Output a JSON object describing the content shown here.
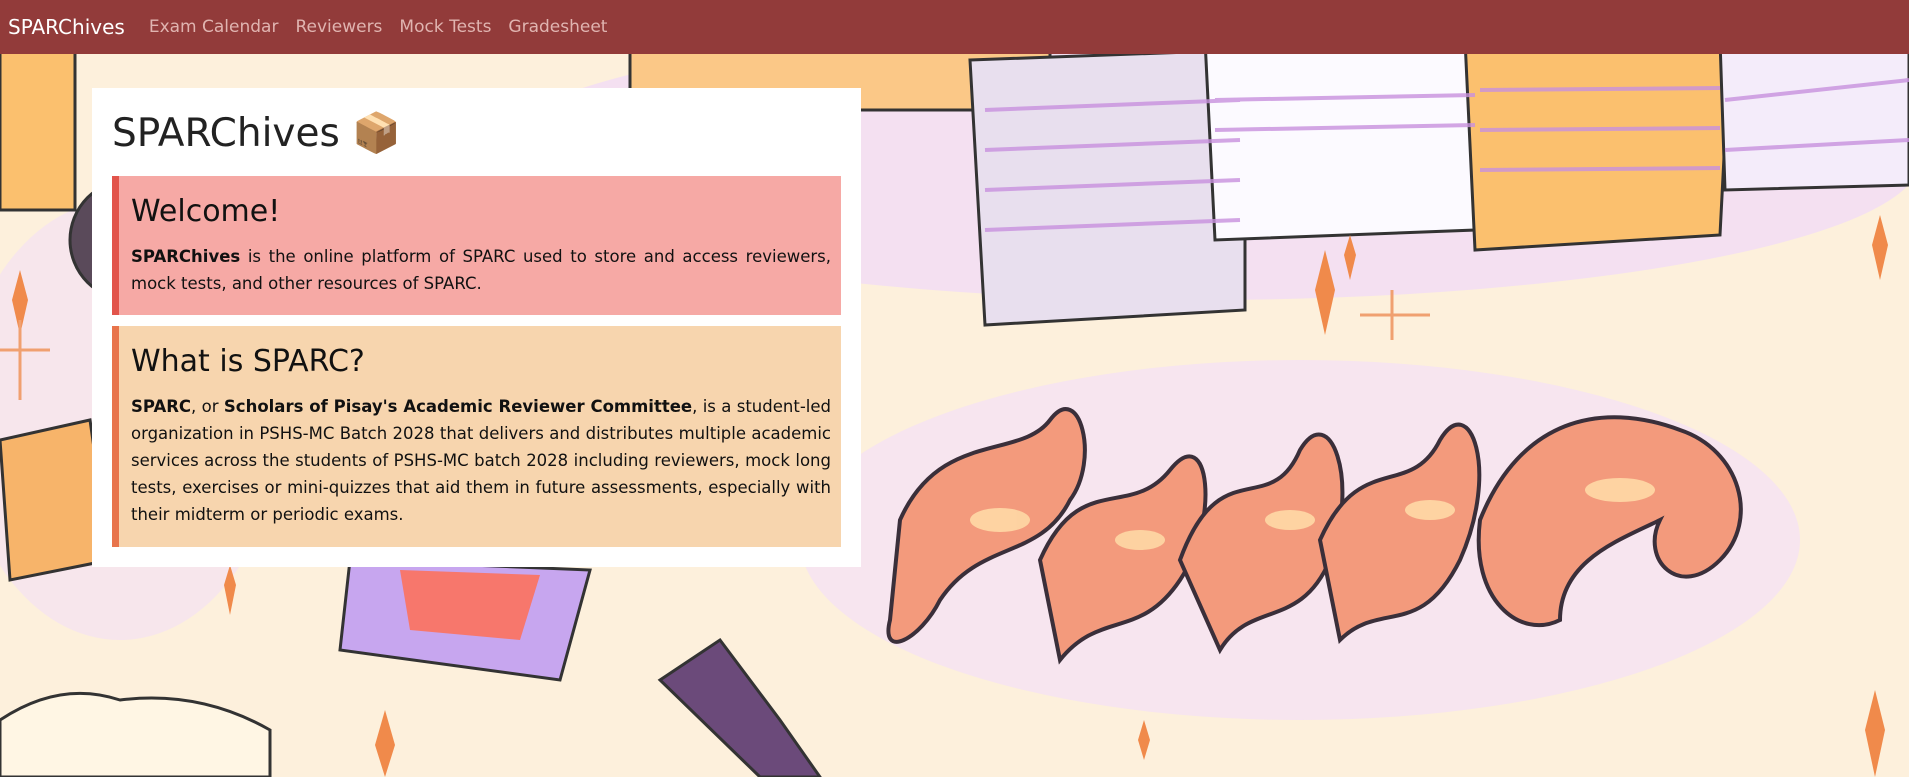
{
  "navbar": {
    "brand": "SPARChives",
    "links": [
      "Exam Calendar",
      "Reviewers",
      "Mock Tests",
      "Gradesheet"
    ]
  },
  "main": {
    "title": "SPARChives 📦",
    "welcome": {
      "heading": "Welcome!",
      "bold": "SPARChives",
      "text": " is the online platform of SPARC used to store and access reviewers, mock tests, and other resources of SPARC."
    },
    "about": {
      "heading": "What is SPARC?",
      "bold1": "SPARC",
      "text1": ", or ",
      "bold2": "Scholars of Pisay's Academic Reviewer Committee",
      "text2": ", is a student-led organization in PSHS-MC Batch 2028 that delivers and distributes multiple academic services across the students of PSHS-MC batch 2028 including reviewers, mock long tests, exercises or mini-quizzes that aid them in future assessments, especially with their midterm or periodic exams."
    }
  },
  "colors": {
    "navbar": "#923b3a",
    "welcome_bg": "#f6a9a5",
    "about_bg": "#f7d5ae",
    "page_bg": "#fdf0dc"
  }
}
